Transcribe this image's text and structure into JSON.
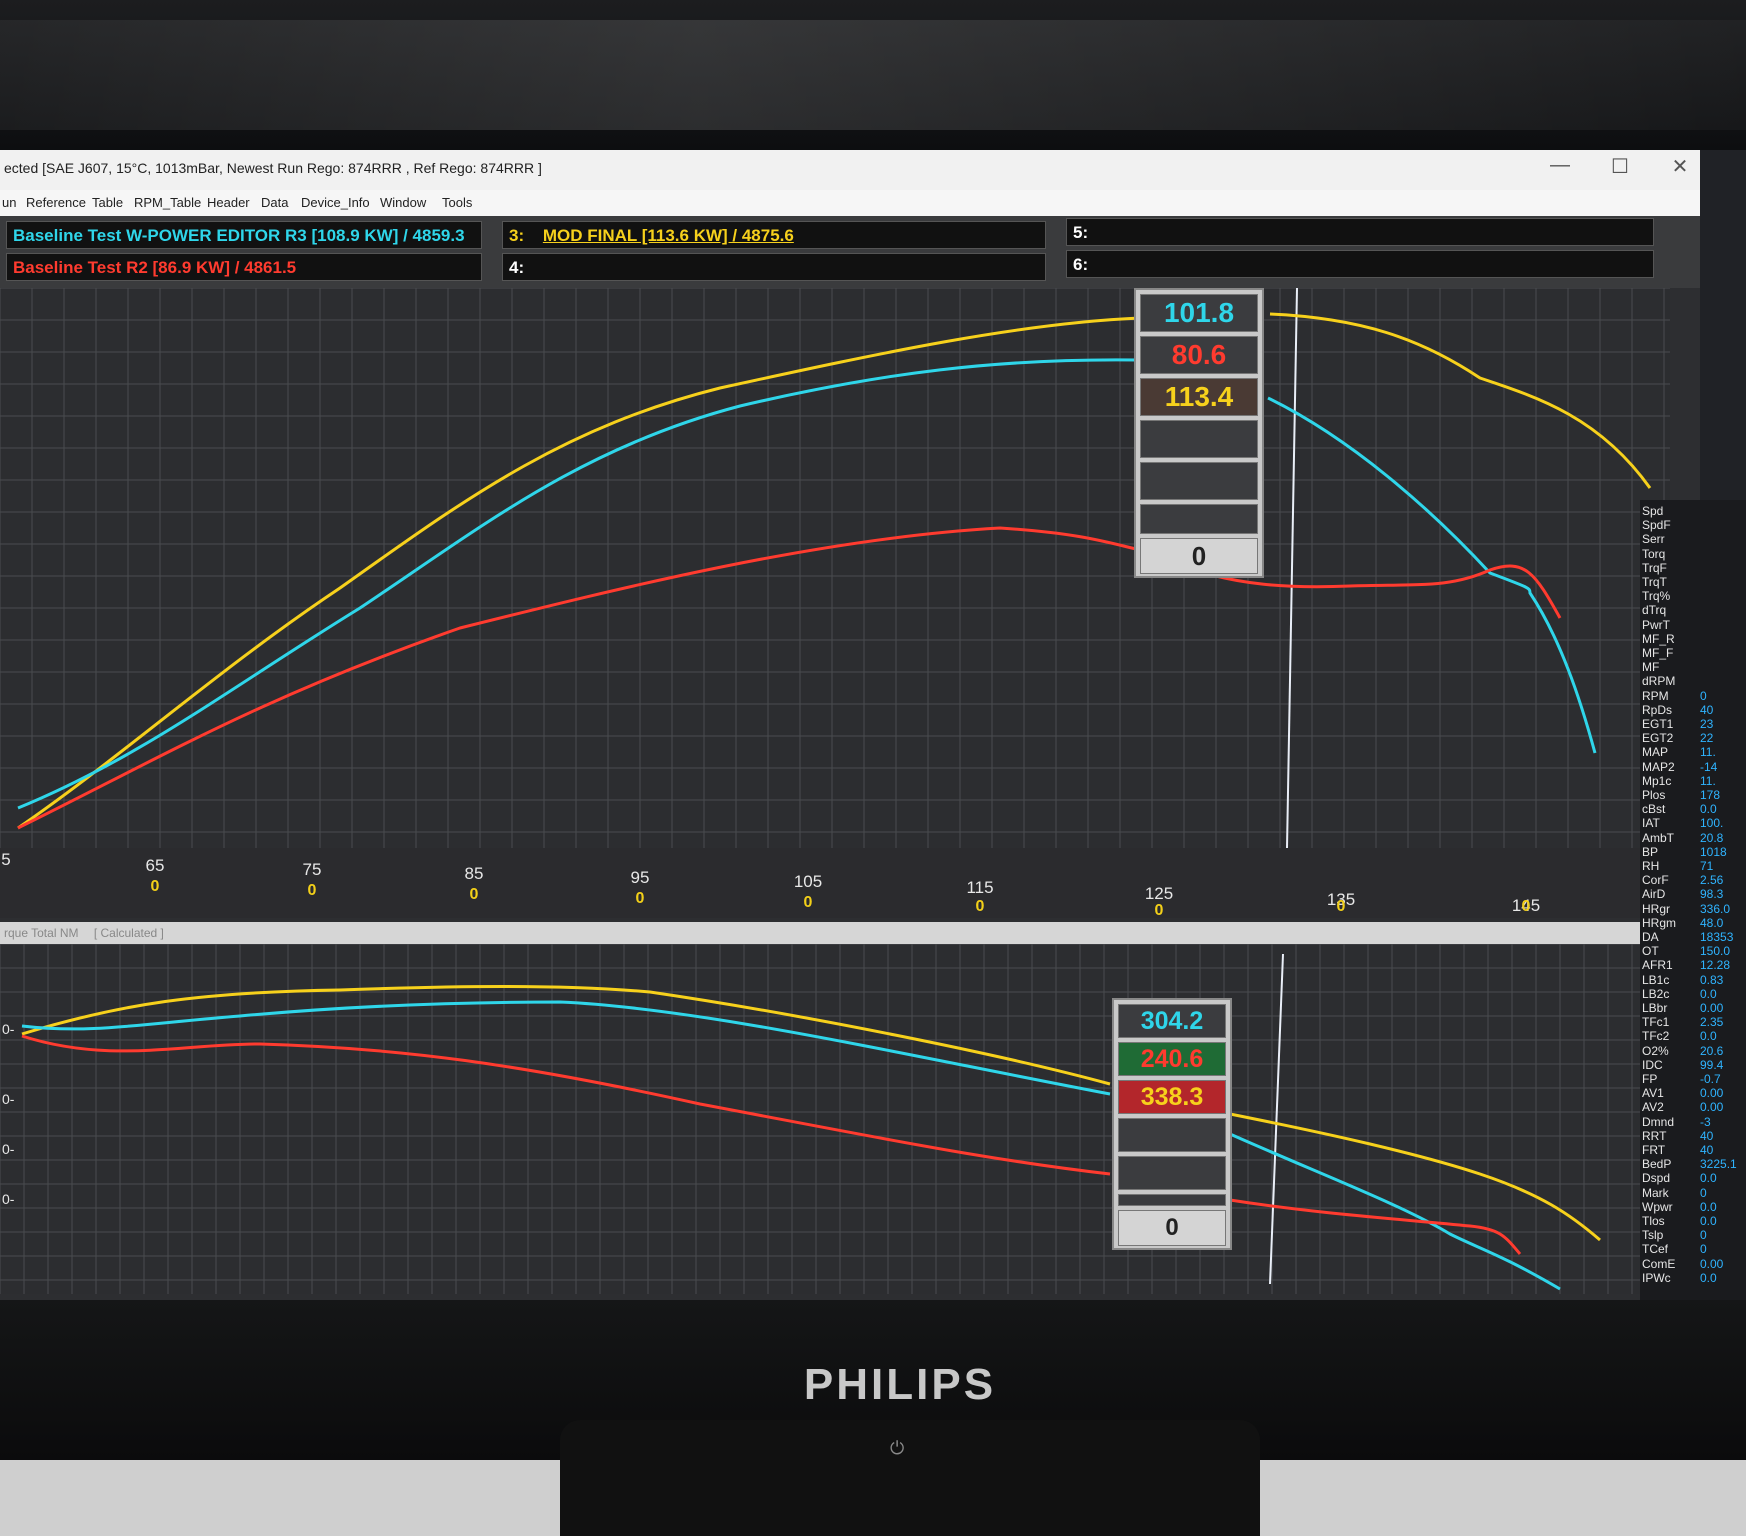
{
  "window": {
    "title": "ected [SAE J607, 15°C, 1013mBar,  Newest Run Rego: 874RRR ,  Ref Rego: 874RRR ]",
    "controls": {
      "minimize": "—",
      "maximize": "☐",
      "close": "✕"
    }
  },
  "menu": [
    "un",
    "Reference",
    "Table",
    "RPM_Table",
    "Header",
    "Data",
    "Device_Info",
    "Window",
    "Tools"
  ],
  "runs": [
    {
      "slot": "",
      "label": "Baseline Test W-POWER EDITOR R3 [108.9 KW] / 4859.3",
      "color": "#2fd6ea"
    },
    {
      "slot": "",
      "label": "Baseline Test R2 [86.9 KW] / 4861.5",
      "color": "#ff3b2f"
    },
    {
      "slot": "3:",
      "label": "MOD FINAL [113.6 KW] / 4875.6",
      "color": "#f7d11c"
    },
    {
      "slot": "4:",
      "label": "",
      "color": "#ffffff"
    },
    {
      "slot": "5:",
      "label": "",
      "color": "#ffffff"
    },
    {
      "slot": "6:",
      "label": "",
      "color": "#ffffff"
    }
  ],
  "power_readout": {
    "values": [
      "101.8",
      "80.6",
      "113.4"
    ],
    "colors": [
      "#2fd6ea",
      "#ff3b2f",
      "#f7d11c"
    ],
    "footer": "0"
  },
  "torque_readout": {
    "values": [
      "304.2",
      "240.6",
      "338.3"
    ],
    "colors": [
      "#2fd6ea",
      "#ff3b2f",
      "#f7d11c"
    ],
    "footer": "0"
  },
  "x_axis": {
    "ticks": [
      "65",
      "75",
      "85",
      "95",
      "105",
      "115",
      "125",
      "135",
      "145"
    ],
    "edge_tick": "5",
    "zero_label": "0"
  },
  "lower_chart": {
    "caption": "rque Total NM",
    "caption_note": "[ Calculated ]",
    "y_ticks": [
      "0-",
      "0-",
      "0-",
      "0-"
    ]
  },
  "channels": [
    {
      "name": "Spd",
      "value": ""
    },
    {
      "name": "SpdF",
      "value": ""
    },
    {
      "name": "Serr",
      "value": ""
    },
    {
      "name": "Torq",
      "value": ""
    },
    {
      "name": "TrqF",
      "value": ""
    },
    {
      "name": "TrqT",
      "value": ""
    },
    {
      "name": "Trq%",
      "value": ""
    },
    {
      "name": "dTrq",
      "value": ""
    },
    {
      "name": "PwrT",
      "value": ""
    },
    {
      "name": "MF_R",
      "value": ""
    },
    {
      "name": "MF_F",
      "value": ""
    },
    {
      "name": "MF",
      "value": ""
    },
    {
      "name": "dRPM",
      "value": ""
    },
    {
      "name": "RPM",
      "value": "0"
    },
    {
      "name": "RpDs",
      "value": "40"
    },
    {
      "name": "EGT1",
      "value": "23"
    },
    {
      "name": "EGT2",
      "value": "22"
    },
    {
      "name": "MAP",
      "value": "11."
    },
    {
      "name": "MAP2",
      "value": "-14"
    },
    {
      "name": "Mp1c",
      "value": "11."
    },
    {
      "name": "Plos",
      "value": "178"
    },
    {
      "name": "cBst",
      "value": "0.0"
    },
    {
      "name": "IAT",
      "value": "100."
    },
    {
      "name": "AmbT",
      "value": "20.8"
    },
    {
      "name": "BP",
      "value": "1018"
    },
    {
      "name": "RH",
      "value": "71"
    },
    {
      "name": "CorF",
      "value": "2.56"
    },
    {
      "name": "AirD",
      "value": "98.3"
    },
    {
      "name": "HRgr",
      "value": "336.0"
    },
    {
      "name": "HRgm",
      "value": "48.0"
    },
    {
      "name": "DA",
      "value": "18353"
    },
    {
      "name": "OT",
      "value": "150.0"
    },
    {
      "name": "AFR1",
      "value": "12.28"
    },
    {
      "name": "LB1c",
      "value": "0.83"
    },
    {
      "name": "LB2c",
      "value": "0.0"
    },
    {
      "name": "LBbr",
      "value": "0.00"
    },
    {
      "name": "TFc1",
      "value": "2.35"
    },
    {
      "name": "TFc2",
      "value": "0.0"
    },
    {
      "name": "O2%",
      "value": "20.6"
    },
    {
      "name": "IDC",
      "value": "99.4"
    },
    {
      "name": "FP",
      "value": "-0.7"
    },
    {
      "name": "AV1",
      "value": "0.00"
    },
    {
      "name": "AV2",
      "value": "0.00"
    },
    {
      "name": "Dmnd",
      "value": "-3"
    },
    {
      "name": "RRT",
      "value": "40"
    },
    {
      "name": "FRT",
      "value": "40"
    },
    {
      "name": "BedP",
      "value": "3225.1"
    },
    {
      "name": "Dspd",
      "value": "0.0"
    },
    {
      "name": "Mark",
      "value": "0"
    },
    {
      "name": "Wpwr",
      "value": "0.0"
    },
    {
      "name": "Tlos",
      "value": "0.0"
    },
    {
      "name": "Tslp",
      "value": "0"
    },
    {
      "name": "TCef",
      "value": "0"
    },
    {
      "name": "ComE",
      "value": "0.00"
    },
    {
      "name": "IPWc",
      "value": "0.0"
    }
  ],
  "monitor": {
    "brand": "PHILIPS",
    "power_icon": "power-icon"
  }
}
